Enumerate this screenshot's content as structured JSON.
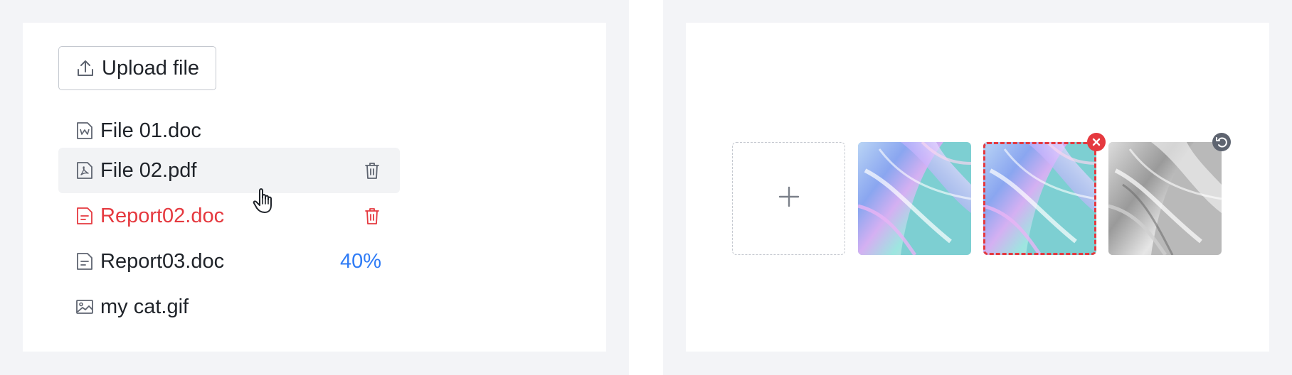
{
  "upload": {
    "button_label": "Upload file",
    "icon": "upload-icon"
  },
  "files": [
    {
      "name": "File 01.doc",
      "icon": "word-file-icon",
      "state": "normal"
    },
    {
      "name": "File 02.pdf",
      "icon": "pdf-file-icon",
      "state": "hover",
      "action": "delete-icon"
    },
    {
      "name": "Report02.doc",
      "icon": "document-icon",
      "state": "error",
      "action": "delete-icon"
    },
    {
      "name": "Report03.doc",
      "icon": "document-icon",
      "state": "uploading",
      "progress_text": "40%",
      "progress": 0.4
    },
    {
      "name": "my cat.gif",
      "icon": "image-file-icon",
      "state": "normal"
    }
  ],
  "picture_wall": {
    "add_icon": "plus-icon",
    "items": [
      {
        "name": "iridescent-image",
        "state": "done"
      },
      {
        "name": "iridescent-image",
        "state": "error",
        "badge": "remove-icon"
      },
      {
        "name": "grayscale-image",
        "state": "removed",
        "badge": "undo-icon"
      }
    ]
  },
  "colors": {
    "accent": "#2f7cf6",
    "error": "#e5393f",
    "text": "#1f2329",
    "icon": "#5e6470",
    "hover_bg": "#f2f3f5",
    "border": "#c4c8cf"
  }
}
